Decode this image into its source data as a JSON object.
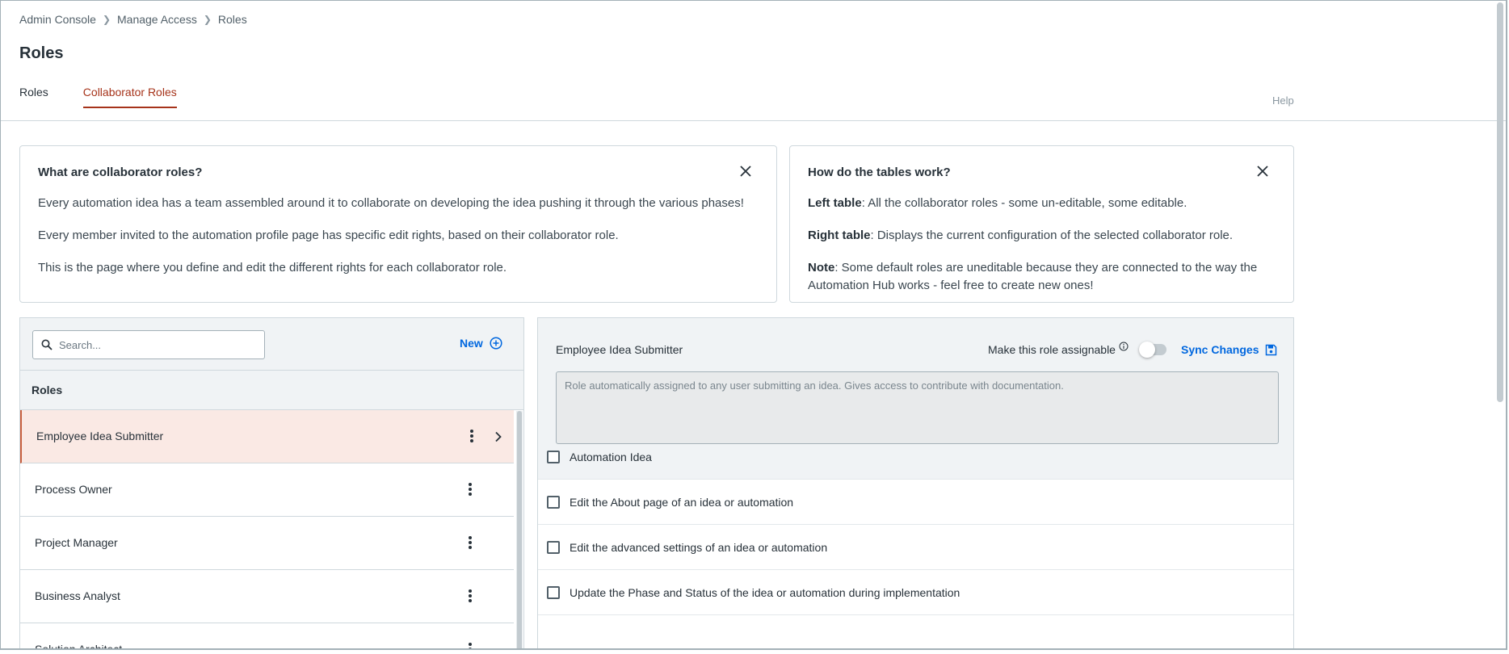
{
  "breadcrumb": [
    "Admin Console",
    "Manage Access",
    "Roles"
  ],
  "page_title": "Roles",
  "tabs": [
    {
      "label": "Roles",
      "active": false
    },
    {
      "label": "Collaborator Roles",
      "active": true
    }
  ],
  "help_label": "Help",
  "info_left": {
    "title": "What are collaborator roles?",
    "paragraphs": [
      "Every automation idea has a team assembled around it to collaborate on developing the idea pushing it through the various phases!",
      "Every member invited to the automation profile page has specific edit rights, based on their collaborator role.",
      "This is the page where you define and edit the different rights for each collaborator role."
    ]
  },
  "info_right": {
    "title": "How do the tables work?",
    "items": [
      {
        "term": "Left table",
        "text": ": All the collaborator roles - some un-editable, some editable."
      },
      {
        "term": "Right table",
        "text": ": Displays the current configuration of the selected collaborator role."
      },
      {
        "term": "Note",
        "text": ": Some default roles are uneditable because they are connected to the way the Automation Hub works - feel free to create new ones!"
      }
    ]
  },
  "roles_panel": {
    "search_placeholder": "Search...",
    "new_label": "New",
    "header": "Roles",
    "roles": [
      "Employee Idea Submitter",
      "Process Owner",
      "Project Manager",
      "Business Analyst",
      "Solution Architect"
    ],
    "selected_index": 0
  },
  "detail": {
    "title": "Employee Idea Submitter",
    "assignable_label": "Make this role assignable",
    "assignable": false,
    "sync_label": "Sync Changes",
    "description": "Role automatically assigned to any user submitting an idea. Gives access to contribute with documentation.",
    "permissions": [
      {
        "label": "Automation Idea",
        "checked": false
      },
      {
        "label": "Edit the About page of an idea or automation",
        "checked": false
      },
      {
        "label": "Edit the advanced settings of an idea or automation",
        "checked": false
      },
      {
        "label": "Update the Phase and Status of the idea or automation during implementation",
        "checked": false
      }
    ]
  },
  "colors": {
    "accent": "#a6331a",
    "link": "#0067df",
    "selected_row": "#fae9e4",
    "panel_bg": "#f0f3f5"
  }
}
